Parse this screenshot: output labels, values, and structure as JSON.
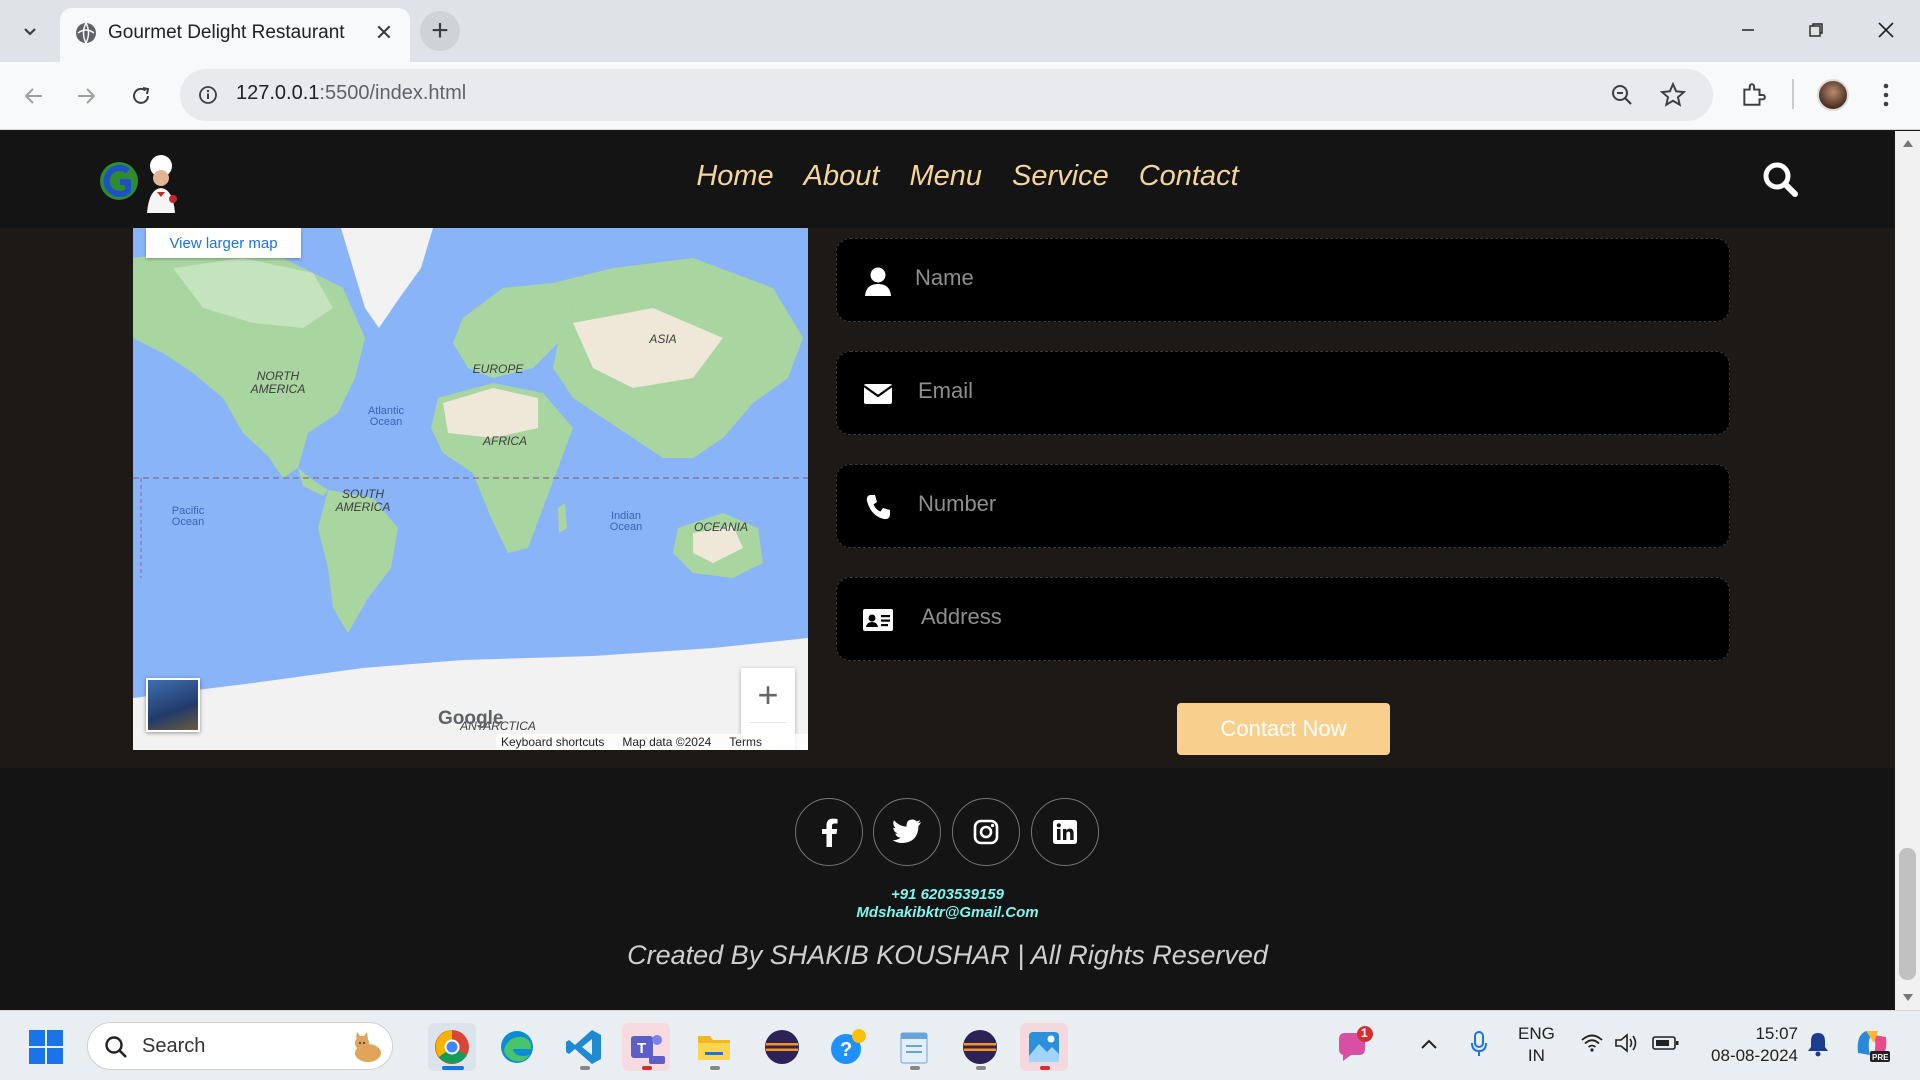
{
  "browser": {
    "tab_title": "Gourmet Delight Restaurant",
    "url_host": "127.0.0.1",
    "url_rest": ":5500/index.html"
  },
  "site": {
    "nav": [
      "Home",
      "About",
      "Menu",
      "Service",
      "Contact"
    ]
  },
  "map": {
    "view_larger": "View larger map",
    "labels": {
      "north_america": "NORTH\nAMERICA",
      "europe": "EUROPE",
      "asia": "ASIA",
      "africa": "AFRICA",
      "south_america": "SOUTH\nAMERICA",
      "oceania": "OCEANIA",
      "antarctica": "ANTARCTICA",
      "atlantic": "Atlantic\nOcean",
      "pacific": "Pacific\nOcean",
      "indian": "Indian\nOcean"
    },
    "google": "Google",
    "footer": [
      "Keyboard shortcuts",
      "Map data ©2024",
      "Terms"
    ]
  },
  "form": {
    "fields": [
      {
        "placeholder": "Name",
        "icon": "user-icon"
      },
      {
        "placeholder": "Email",
        "icon": "envelope-icon"
      },
      {
        "placeholder": "Number",
        "icon": "phone-icon"
      },
      {
        "placeholder": "Address",
        "icon": "address-card-icon"
      }
    ],
    "submit_label": "Contact Now"
  },
  "footer": {
    "socials": [
      "facebook-icon",
      "twitter-icon",
      "instagram-icon",
      "linkedin-icon"
    ],
    "phone": "+91 6203539159",
    "email": "Mdshakibktr@Gmail.Com",
    "credits": "Created By SHAKIB KOUSHAR | All Rights Reserved"
  },
  "taskbar": {
    "search_label": "Search",
    "lang_line1": "ENG",
    "lang_line2": "IN",
    "time": "15:07",
    "date": "08-08-2024",
    "notification_count": "1"
  },
  "colors": {
    "accent": "#f8cf8c",
    "nav_text": "#f5d59b",
    "footer_contact": "#7ff5f0"
  }
}
